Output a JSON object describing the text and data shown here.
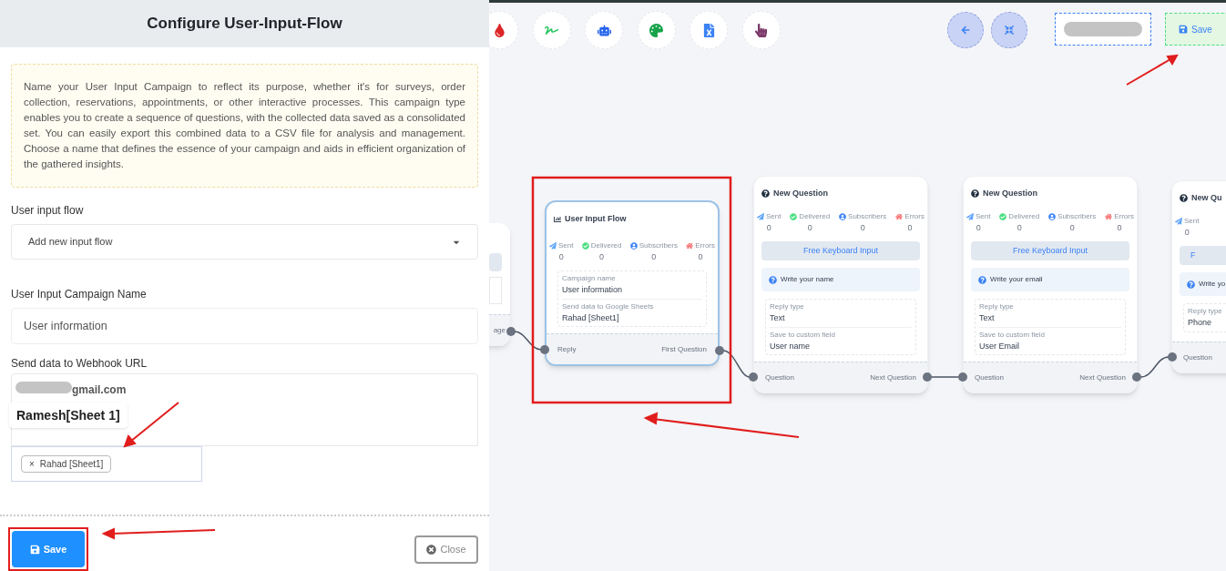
{
  "panel": {
    "title": "Configure User-Input-Flow",
    "info": "Name your User Input Campaign to reflect its purpose, whether it's for surveys, order collection, reservations, appointments, or other interactive processes. This campaign type enables you to create a sequence of questions, with the collected data saved as a consolidated set. You can easily export this combined data to a CSV file for analysis and management. Choose a name that defines the essence of your campaign and aids in efficient organization of the gathered insights.",
    "flow_select": {
      "label": "User input flow",
      "value": "Add new input flow"
    },
    "campaign_name": {
      "label": "User Input Campaign Name",
      "value": "User information"
    },
    "webhook": {
      "label": "Send data to Webhook URL",
      "value": "gmail.com"
    },
    "callout": "Ramesh[Sheet 1]",
    "sheet_tags": [
      {
        "remove": "×",
        "label": "Rahad [Sheet1]"
      }
    ],
    "save": "Save",
    "close": "Close"
  },
  "toolbar": {
    "save": "Save"
  },
  "side_node": {
    "port_label": "age"
  },
  "nodes": [
    {
      "kind": "flow",
      "title": "User Input Flow",
      "stats": [
        {
          "label": "Sent",
          "value": "0"
        },
        {
          "label": "Delivered",
          "value": "0"
        },
        {
          "label": "Subscribers",
          "value": "0"
        },
        {
          "label": "Errors",
          "value": "0"
        }
      ],
      "fields": [
        {
          "label": "Campaign name",
          "value": "User information"
        },
        {
          "label": "Send data to Google Sheets",
          "value": "Rahad [Sheet1]"
        }
      ],
      "in_port": "Reply",
      "out_port": "First Question"
    },
    {
      "kind": "question",
      "title": "New Question",
      "stats": [
        {
          "label": "Sent",
          "value": "0"
        },
        {
          "label": "Delivered",
          "value": "0"
        },
        {
          "label": "Subscribers",
          "value": "0"
        },
        {
          "label": "Errors",
          "value": "0"
        }
      ],
      "input_button": "Free Keyboard Input",
      "prompt": "Write your name",
      "fields": [
        {
          "label": "Reply type",
          "value": "Text"
        },
        {
          "label": "Save to custom field",
          "value": "User name"
        }
      ],
      "in_port": "Question",
      "out_port": "Next Question"
    },
    {
      "kind": "question",
      "title": "New Question",
      "stats": [
        {
          "label": "Sent",
          "value": "0"
        },
        {
          "label": "Delivered",
          "value": "0"
        },
        {
          "label": "Subscribers",
          "value": "0"
        },
        {
          "label": "Errors",
          "value": "0"
        }
      ],
      "input_button": "Free Keyboard Input",
      "prompt": "Write your email",
      "fields": [
        {
          "label": "Reply type",
          "value": "Text"
        },
        {
          "label": "Save to custom field",
          "value": "User Email"
        }
      ],
      "in_port": "Question",
      "out_port": "Next Question"
    },
    {
      "kind": "question",
      "title": "New Qu",
      "stats": [
        {
          "label": "Sent",
          "value": "0"
        }
      ],
      "input_button": "F",
      "prompt": "Write yo",
      "fields": [
        {
          "label": "Reply type",
          "value": "Phone"
        }
      ],
      "in_port": "Question"
    }
  ]
}
